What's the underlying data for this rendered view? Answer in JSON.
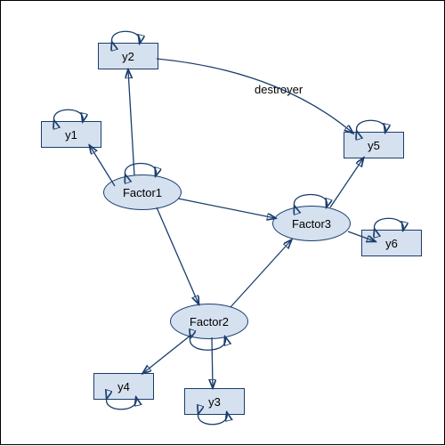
{
  "diagram": {
    "type": "SEM-path-diagram",
    "latent_factors": {
      "f1": "Factor1",
      "f2": "Factor2",
      "f3": "Factor3"
    },
    "observed_vars": {
      "y1": "y1",
      "y2": "y2",
      "y3": "y3",
      "y4": "y4",
      "y5": "y5",
      "y6": "y6"
    },
    "edge_labels": {
      "destroyer": "destroyer"
    },
    "edges_directed": [
      [
        "Factor1",
        "y1"
      ],
      [
        "Factor1",
        "y2"
      ],
      [
        "Factor1",
        "Factor2"
      ],
      [
        "Factor1",
        "Factor3"
      ],
      [
        "Factor2",
        "y3"
      ],
      [
        "Factor2",
        "y4"
      ],
      [
        "Factor2",
        "Factor3"
      ],
      [
        "Factor3",
        "y5"
      ],
      [
        "Factor3",
        "y6"
      ],
      [
        "y2",
        "y5"
      ]
    ],
    "self_loops": [
      "y1",
      "y2",
      "y3",
      "y4",
      "y5",
      "y6",
      "Factor1",
      "Factor2",
      "Factor3"
    ]
  }
}
